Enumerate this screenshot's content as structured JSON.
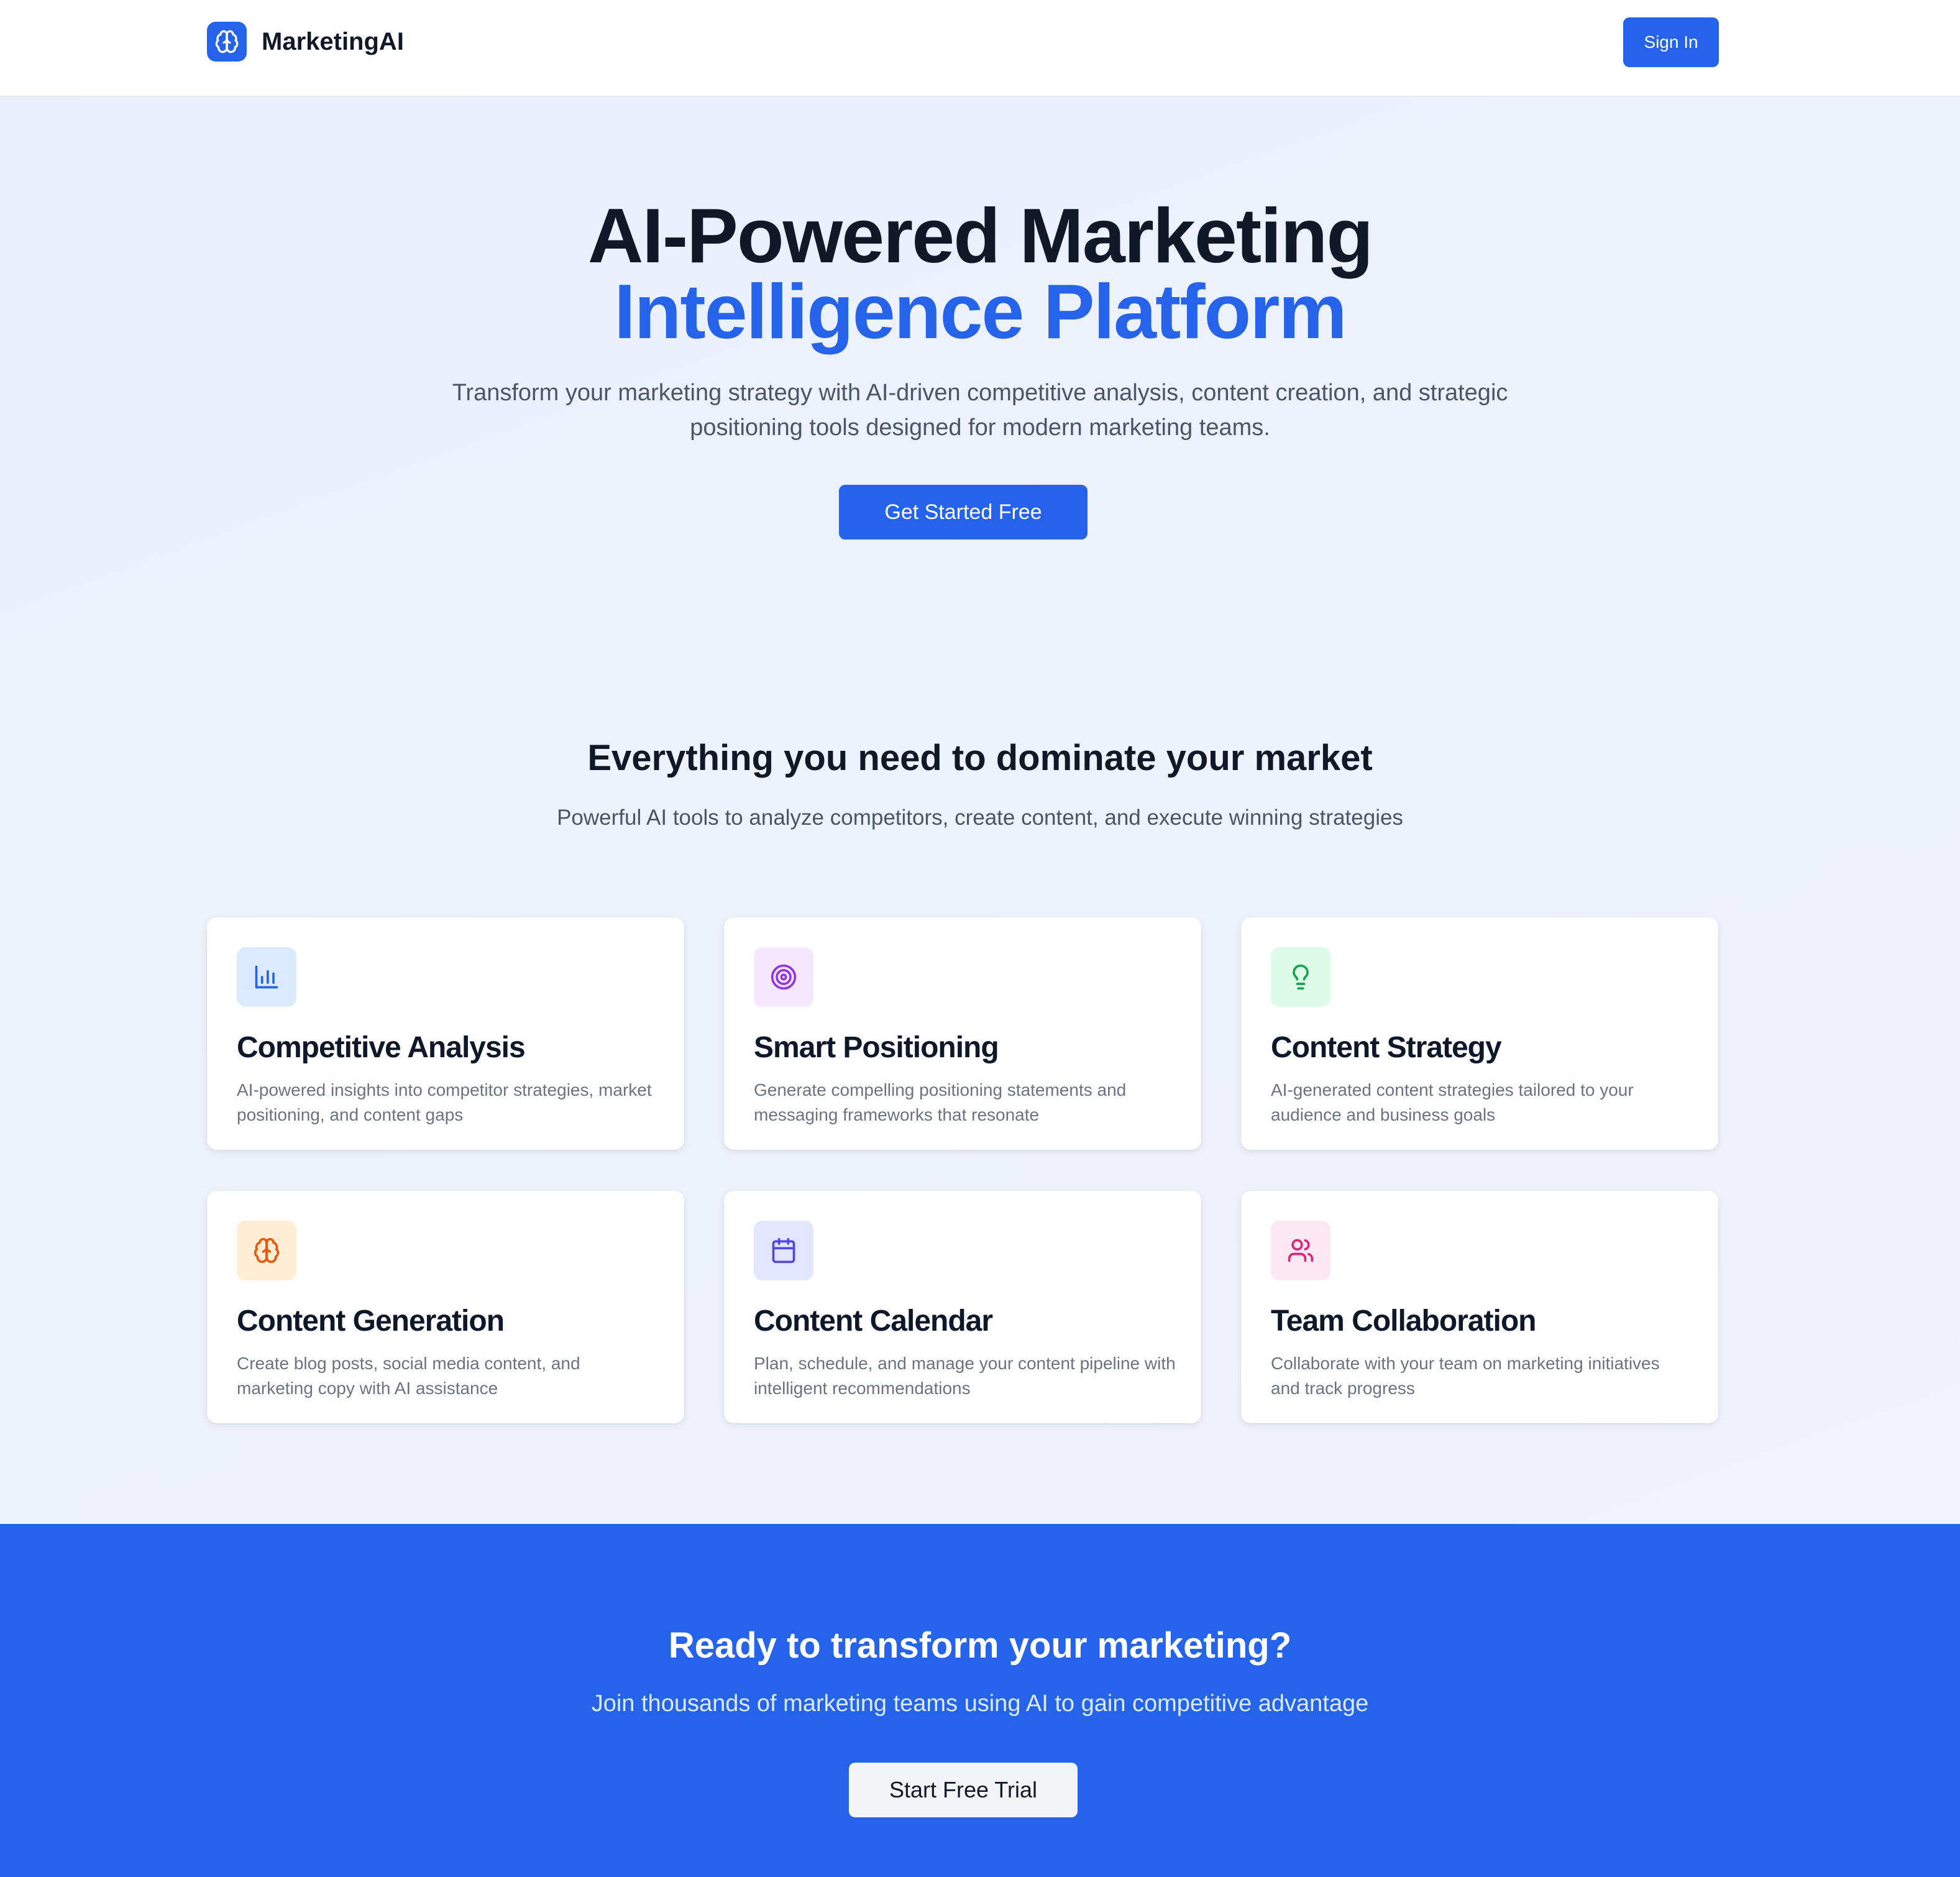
{
  "header": {
    "brand_name": "MarketingAI",
    "brand_icon": "brain-icon",
    "sign_in_label": "Sign In"
  },
  "hero": {
    "title_line1": "AI-Powered Marketing",
    "title_line2": "Intelligence Platform",
    "subtitle": "Transform your marketing strategy with AI-driven competitive analysis, content creation, and strategic positioning tools designed for modern marketing teams.",
    "cta_label": "Get Started Free"
  },
  "features": {
    "title": "Everything you need to dominate your market",
    "subtitle": "Powerful AI tools to analyze competitors, create content, and execute winning strategies",
    "cards": [
      {
        "title": "Competitive Analysis",
        "description": "AI-powered insights into competitor strategies, market positioning, and content gaps",
        "icon": "bar-chart-icon",
        "icon_color": "#2563eb",
        "icon_bg": "#dbeafe"
      },
      {
        "title": "Smart Positioning",
        "description": "Generate compelling positioning statements and messaging frameworks that resonate",
        "icon": "target-icon",
        "icon_color": "#9333ea",
        "icon_bg": "#f3e8ff"
      },
      {
        "title": "Content Strategy",
        "description": "AI-generated content strategies tailored to your audience and business goals",
        "icon": "lightbulb-icon",
        "icon_color": "#16a34a",
        "icon_bg": "#dcfce7"
      },
      {
        "title": "Content Generation",
        "description": "Create blog posts, social media content, and marketing copy with AI assistance",
        "icon": "brain-icon",
        "icon_color": "#ea580c",
        "icon_bg": "#ffedd5"
      },
      {
        "title": "Content Calendar",
        "description": "Plan, schedule, and manage your content pipeline with intelligent recommendations",
        "icon": "calendar-icon",
        "icon_color": "#4f46e5",
        "icon_bg": "#e0e7ff"
      },
      {
        "title": "Team Collaboration",
        "description": "Collaborate with your team on marketing initiatives and track progress",
        "icon": "users-icon",
        "icon_color": "#db2777",
        "icon_bg": "#fce7f3"
      }
    ]
  },
  "cta": {
    "title": "Ready to transform your marketing?",
    "subtitle": "Join thousands of marketing teams using AI to gain competitive advantage",
    "button_label": "Start Free Trial"
  },
  "colors": {
    "accent": "#2563eb",
    "heading": "#111827",
    "body_text": "#4b5563"
  }
}
